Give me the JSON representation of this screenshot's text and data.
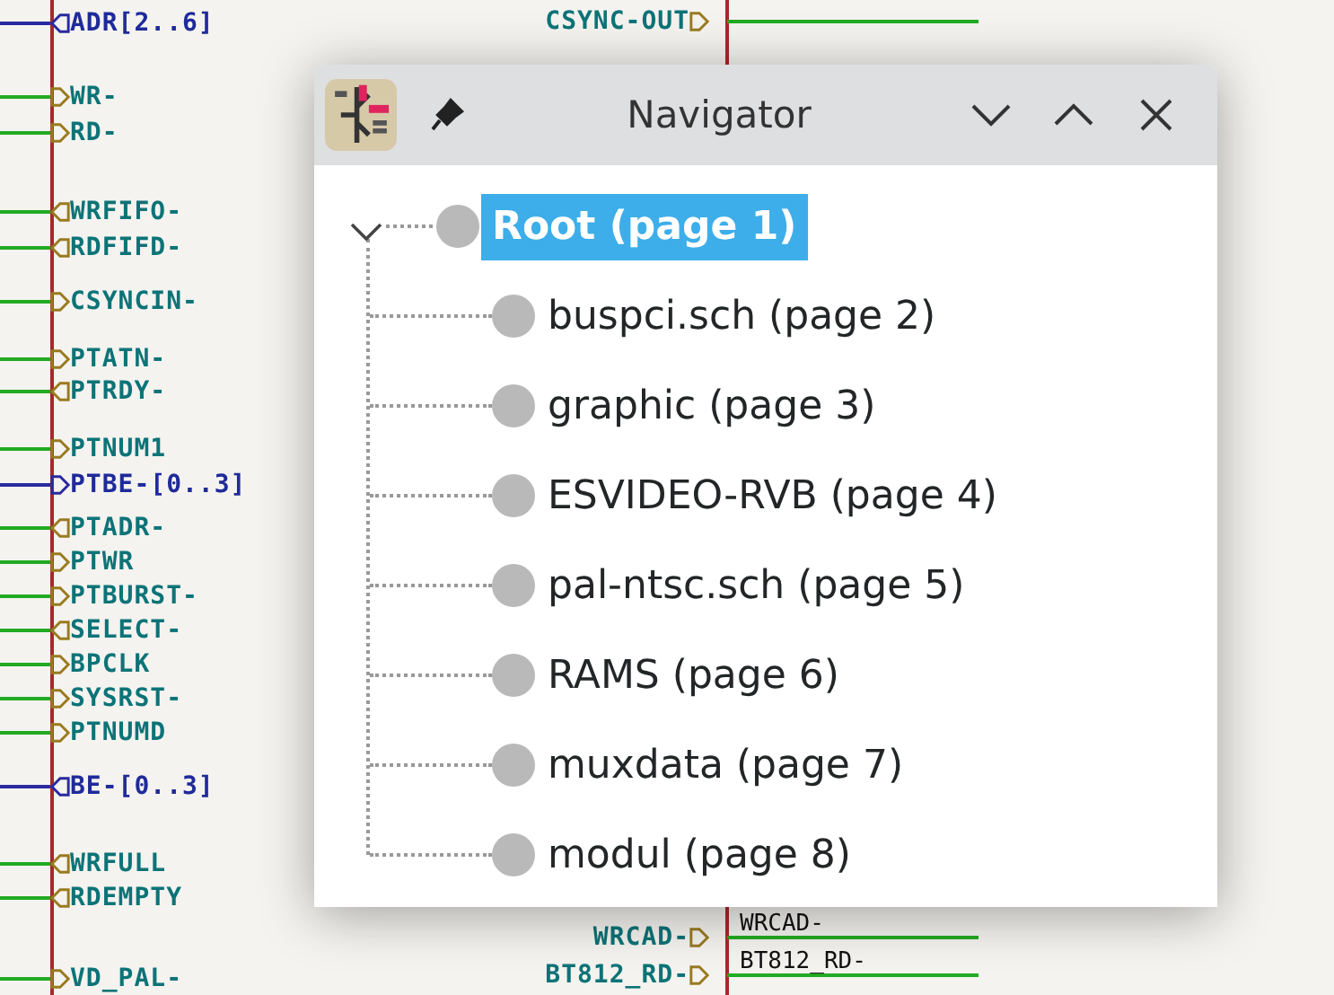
{
  "schematic": {
    "left_labels": [
      {
        "text": "ADR[2..6]",
        "kind": "output",
        "bus": true
      },
      {
        "text": "WR-",
        "kind": "input",
        "bus": false
      },
      {
        "text": "RD-",
        "kind": "input",
        "bus": false
      },
      {
        "text": "WRFIFO-",
        "kind": "output",
        "bus": false
      },
      {
        "text": "RDFIFD-",
        "kind": "output",
        "bus": false
      },
      {
        "text": "CSYNCIN-",
        "kind": "input",
        "bus": false
      },
      {
        "text": "PTATN-",
        "kind": "input",
        "bus": false
      },
      {
        "text": "PTRDY-",
        "kind": "output",
        "bus": false
      },
      {
        "text": "PTNUM1",
        "kind": "input",
        "bus": false
      },
      {
        "text": "PTBE-[0..3]",
        "kind": "input",
        "bus": true
      },
      {
        "text": "PTADR-",
        "kind": "output",
        "bus": false
      },
      {
        "text": "PTWR",
        "kind": "input",
        "bus": false
      },
      {
        "text": "PTBURST-",
        "kind": "input",
        "bus": false
      },
      {
        "text": "SELECT-",
        "kind": "output",
        "bus": false
      },
      {
        "text": "BPCLK",
        "kind": "input",
        "bus": false
      },
      {
        "text": "SYSRST-",
        "kind": "input",
        "bus": false
      },
      {
        "text": "PTNUMD",
        "kind": "input",
        "bus": false
      },
      {
        "text": "BE-[0..3]",
        "kind": "output",
        "bus": true
      },
      {
        "text": "WRFULL",
        "kind": "output",
        "bus": false
      },
      {
        "text": "RDEMPTY",
        "kind": "output",
        "bus": false
      },
      {
        "text": "VD_PAL-",
        "kind": "input",
        "bus": false
      }
    ],
    "center_labels": [
      {
        "text": "CSYNC-OUT",
        "kind": "input"
      },
      {
        "text": "WRCAD-",
        "kind": "input",
        "net": "WRCAD-"
      },
      {
        "text": "BT812_RD-",
        "kind": "input",
        "net": "BT812_RD-"
      }
    ]
  },
  "navigator": {
    "title": "Navigator",
    "root": {
      "label": "Root (page 1)",
      "selected": true,
      "expanded": true,
      "children": [
        {
          "label": "buspci.sch (page 2)",
          "selected": false
        },
        {
          "label": "graphic (page 3)",
          "selected": false
        },
        {
          "label": "ESVIDEO-RVB (page 4)",
          "selected": false
        },
        {
          "label": "pal-ntsc.sch (page 5)",
          "selected": false
        },
        {
          "label": "RAMS (page 6)",
          "selected": false
        },
        {
          "label": "muxdata (page 7)",
          "selected": false
        },
        {
          "label": "modul (page 8)",
          "selected": false
        }
      ]
    }
  }
}
